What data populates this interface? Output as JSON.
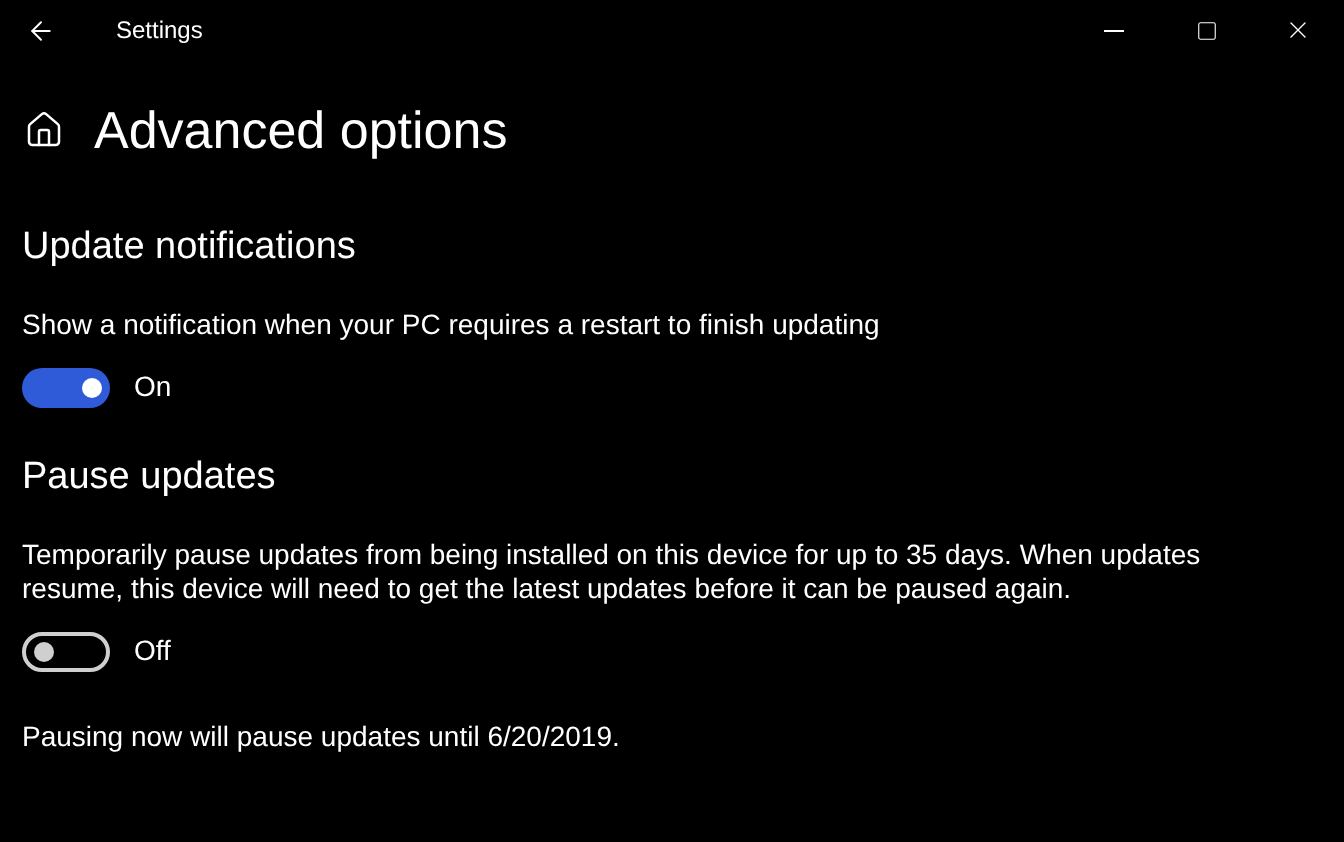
{
  "window": {
    "title": "Settings"
  },
  "page_title": "Advanced options",
  "sections": [
    {
      "heading": "Update notifications",
      "description": "Show a notification when your PC requires a restart to finish updating",
      "toggle": {
        "on": true,
        "label": "On"
      }
    },
    {
      "heading": "Pause updates",
      "description": "Temporarily pause updates from being installed on this device for up to 35 days. When updates resume, this device will need to get the latest updates before it can be paused again.",
      "toggle": {
        "on": false,
        "label": "Off"
      },
      "note": "Pausing now will pause updates until 6/20/2019."
    }
  ]
}
